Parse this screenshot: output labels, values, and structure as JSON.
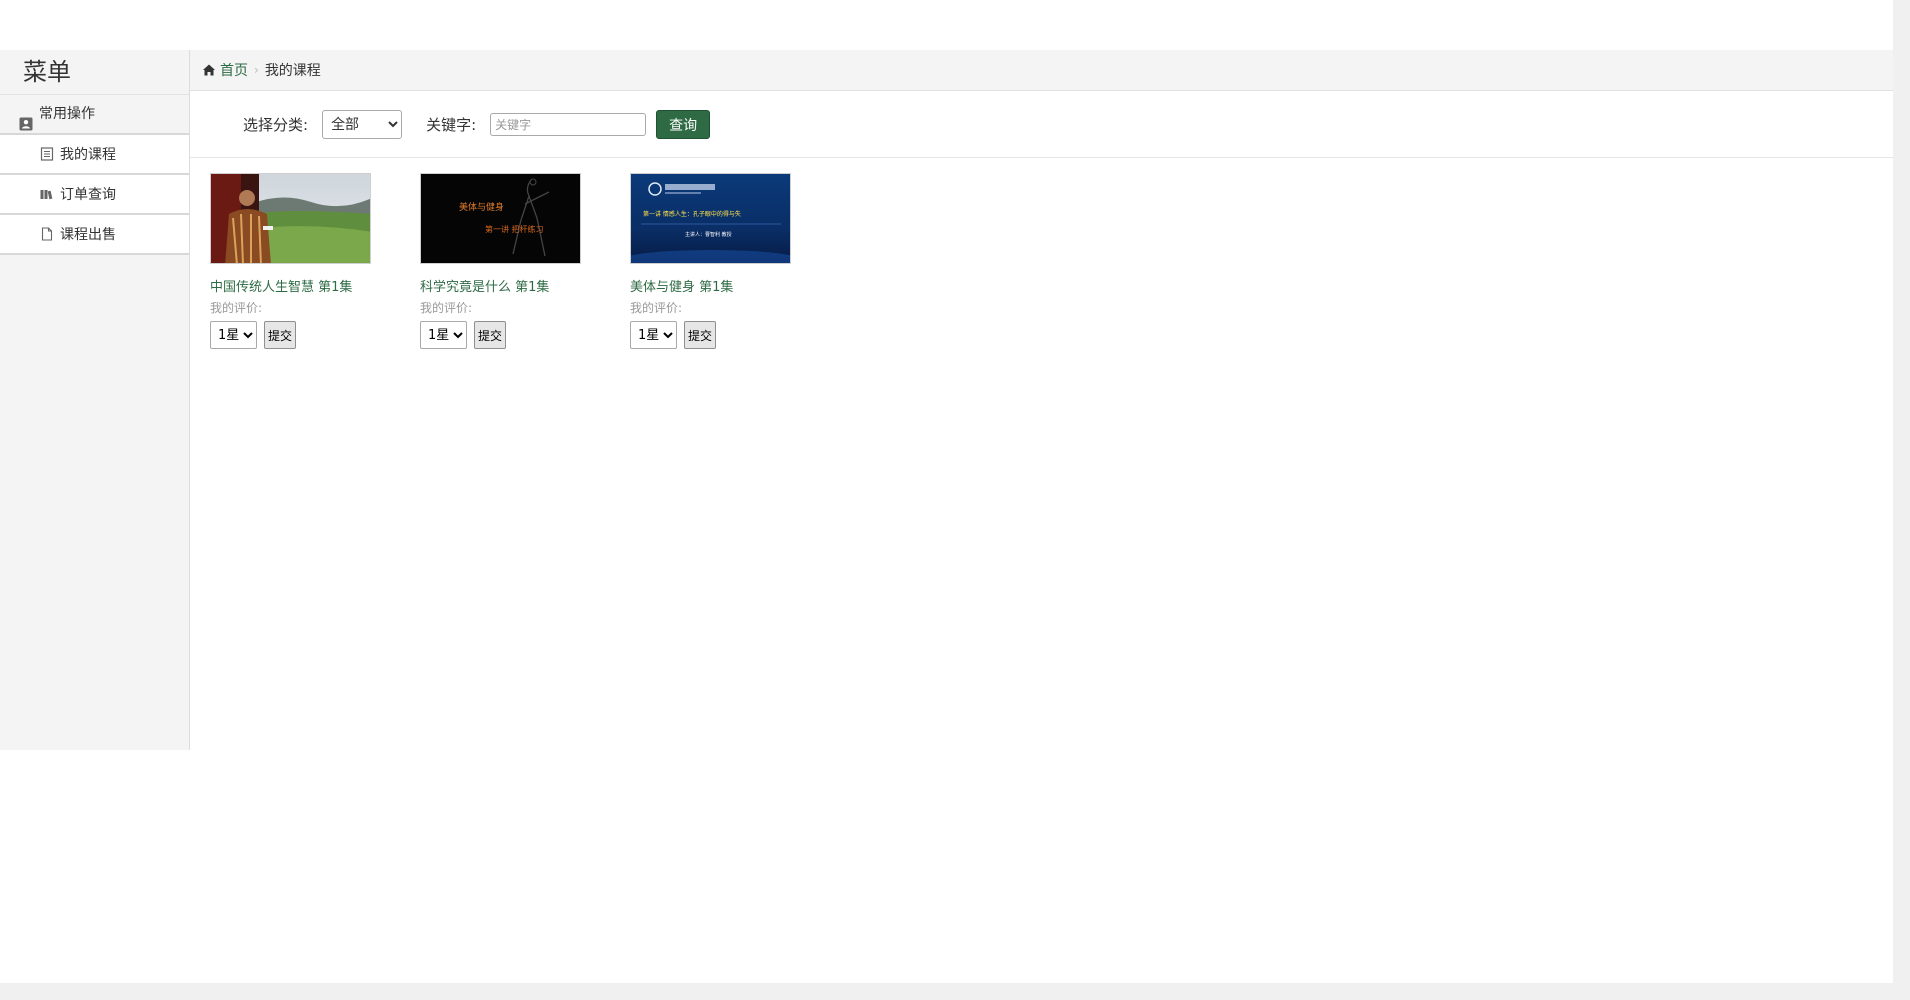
{
  "sidebar": {
    "title": "菜单",
    "group_label": "常用操作",
    "items": [
      {
        "label": "我的课程",
        "icon": "list-icon"
      },
      {
        "label": "订单查询",
        "icon": "books-icon"
      },
      {
        "label": "课程出售",
        "icon": "file-icon"
      }
    ]
  },
  "breadcrumb": {
    "home": "首页",
    "current": "我的课程"
  },
  "filter": {
    "category_label": "选择分类:",
    "category_selected": "全部",
    "keyword_label": "关键字:",
    "keyword_placeholder": "关键字",
    "query_label": "查询"
  },
  "courses": [
    {
      "title": "中国传统人生智慧 第1集",
      "rating_label": "我的评价:",
      "rating_value": "1星",
      "submit_label": "提交"
    },
    {
      "title": "科学究竟是什么 第1集",
      "rating_label": "我的评价:",
      "rating_value": "1星",
      "submit_label": "提交",
      "thumb_text": [
        "美体与健身",
        "第一讲 把杆练习"
      ]
    },
    {
      "title": "美体与健身 第1集",
      "rating_label": "我的评价:",
      "rating_value": "1星",
      "submit_label": "提交",
      "thumb_text": [
        "第一讲 情感人生：孔子眼中的得与失",
        "主讲人：曹智利 教授"
      ]
    }
  ],
  "colors": {
    "accent": "#2e6b44",
    "sidebar_bg": "#f4f4f4"
  }
}
